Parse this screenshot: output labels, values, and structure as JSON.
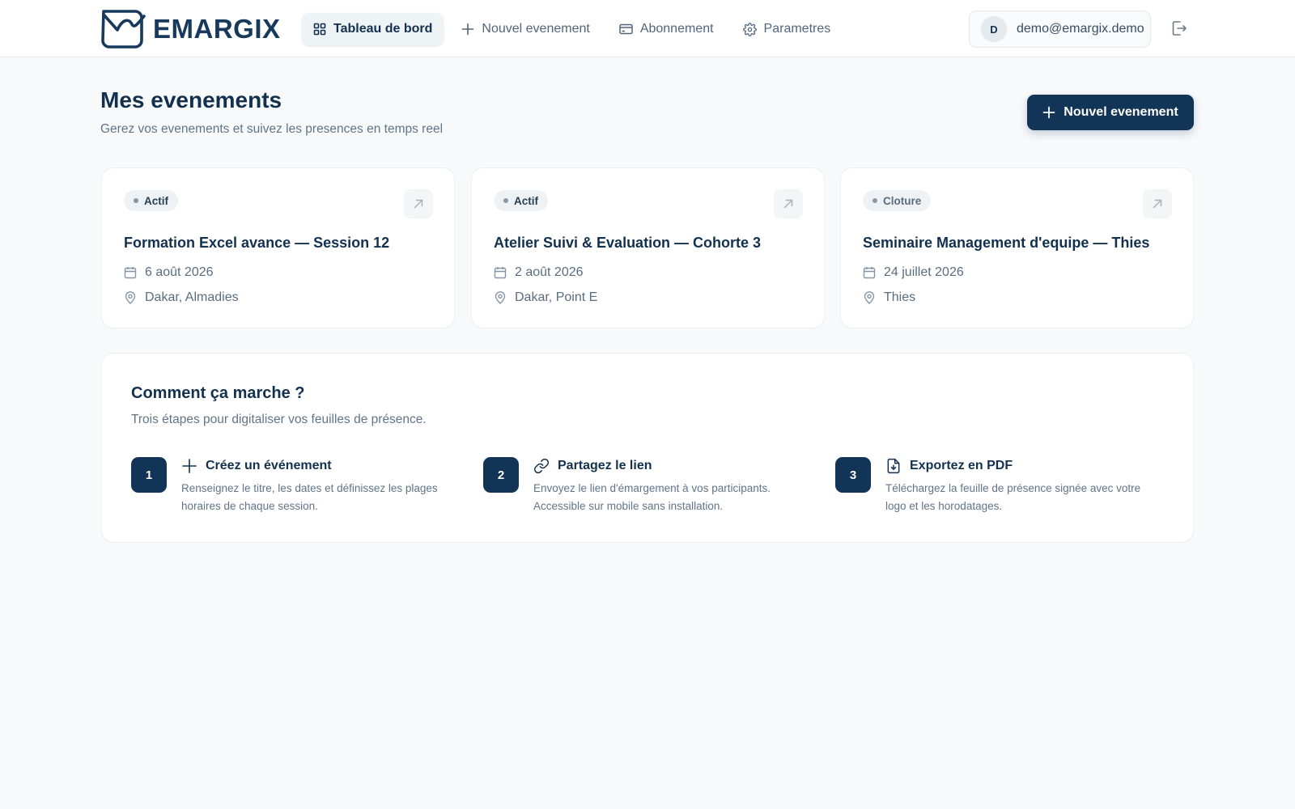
{
  "brand": {
    "name": "EMARGIX"
  },
  "nav": {
    "items": [
      {
        "label": "Tableau de bord",
        "icon": "dashboard-icon",
        "active": true
      },
      {
        "label": "Nouvel evenement",
        "icon": "plus-icon"
      },
      {
        "label": "Abonnement",
        "icon": "credit-card-icon"
      },
      {
        "label": "Parametres",
        "icon": "gear-icon"
      }
    ]
  },
  "user": {
    "initial": "D",
    "email": "demo@emargix.demo"
  },
  "page": {
    "title": "Mes evenements",
    "subtitle": "Gerez vos evenements et suivez les presences en temps reel",
    "new_event_label": "Nouvel evenement"
  },
  "events": [
    {
      "status": "Actif",
      "title": "Formation Excel avance — Session 12",
      "date": "6 août 2026",
      "location": "Dakar, Almadies"
    },
    {
      "status": "Actif",
      "title": "Atelier Suivi & Evaluation — Cohorte 3",
      "date": "2 août 2026",
      "location": "Dakar, Point E"
    },
    {
      "status": "Cloture",
      "title": "Seminaire Management d'equipe — Thies",
      "date": "24 juillet 2026",
      "location": "Thies"
    }
  ],
  "how": {
    "title": "Comment ça marche ?",
    "subtitle": "Trois étapes pour digitaliser vos feuilles de présence.",
    "steps": [
      {
        "number": "1",
        "icon": "plus-icon",
        "title": "Créez un événement",
        "description": "Renseignez le titre, les dates et définissez les plages horaires de chaque session."
      },
      {
        "number": "2",
        "icon": "link-icon",
        "title": "Partagez le lien",
        "description": "Envoyez le lien d'émargement à vos participants. Accessible sur mobile sans installation."
      },
      {
        "number": "3",
        "icon": "file-download-icon",
        "title": "Exportez en PDF",
        "description": "Téléchargez la feuille de présence signée avec votre logo et les horodatages."
      }
    ]
  },
  "colors": {
    "primary": "#123456",
    "text": "#13314f",
    "muted": "#627487",
    "background": "#f7f9fb"
  }
}
